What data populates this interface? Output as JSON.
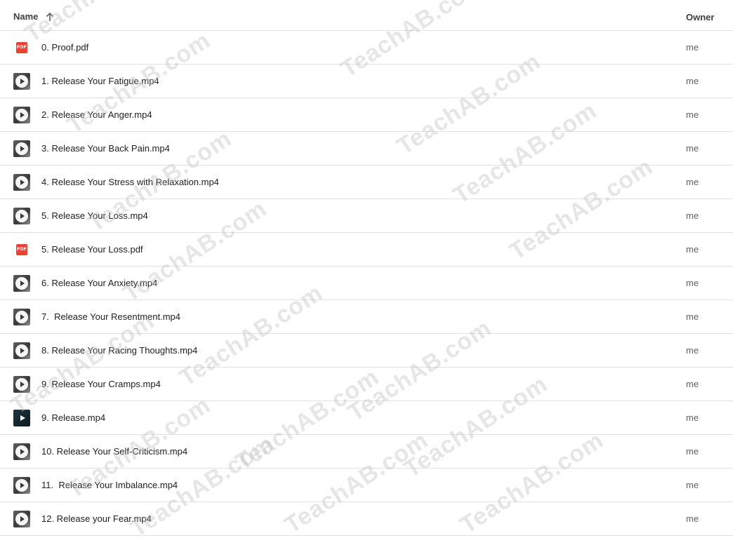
{
  "header": {
    "name_label": "Name",
    "owner_label": "Owner",
    "sort_icon": "arrow-up-icon"
  },
  "files": [
    {
      "name": "0. Proof.pdf",
      "owner": "me",
      "type": "pdf"
    },
    {
      "name": "1. Release Your Fatigue.mp4",
      "owner": "me",
      "type": "video"
    },
    {
      "name": "2. Release Your Anger.mp4",
      "owner": "me",
      "type": "video"
    },
    {
      "name": "3. Release Your Back Pain.mp4",
      "owner": "me",
      "type": "video"
    },
    {
      "name": "4. Release Your Stress with Relaxation.mp4",
      "owner": "me",
      "type": "video"
    },
    {
      "name": "5. Release Your Loss.mp4",
      "owner": "me",
      "type": "video"
    },
    {
      "name": "5. Release Your Loss.pdf",
      "owner": "me",
      "type": "pdf"
    },
    {
      "name": "6. Release Your Anxiety.mp4",
      "owner": "me",
      "type": "video"
    },
    {
      "name": "7.  Release Your Resentment.mp4",
      "owner": "me",
      "type": "video"
    },
    {
      "name": "8. Release Your Racing Thoughts.mp4",
      "owner": "me",
      "type": "video"
    },
    {
      "name": "9. Release Your Cramps.mp4",
      "owner": "me",
      "type": "video"
    },
    {
      "name": "9. Release.mp4",
      "owner": "me",
      "type": "video-dark"
    },
    {
      "name": "10. Release Your Self-Criticism.mp4",
      "owner": "me",
      "type": "video"
    },
    {
      "name": "11.  Release Your Imbalance.mp4",
      "owner": "me",
      "type": "video"
    },
    {
      "name": "12. Release your Fear.mp4",
      "owner": "me",
      "type": "video"
    }
  ],
  "pdf_badge": "PDF",
  "watermark_text": "TeachAB.com",
  "colors": {
    "pdf_red": "#ea4335",
    "divider": "#e2e2e2",
    "owner_text": "#5f6368"
  }
}
